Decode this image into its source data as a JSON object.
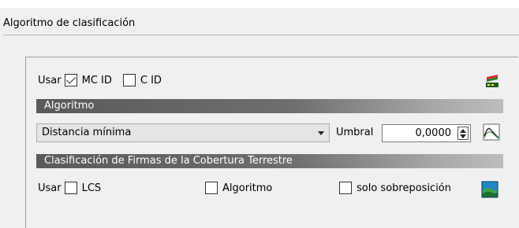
{
  "section_title": "Algoritmo de clasificación",
  "top_row": {
    "use_label": "Usar",
    "mc_id_label": "MC ID",
    "mc_id_checked": true,
    "c_id_label": "C ID",
    "c_id_checked": false,
    "icon": "signature-tool-icon"
  },
  "algorithm_bar": "Algoritmo",
  "algorithm_select": {
    "value": "Distancia mínima",
    "icon": "chevron-down-icon"
  },
  "threshold": {
    "label": "Umbral",
    "value": "0,0000",
    "icon": "spectral-plot-icon"
  },
  "lcs_bar": "Clasificación de Firmas de la Cobertura Terrestre",
  "bottom_row": {
    "use_label": "Usar",
    "lcs_label": "LCS",
    "algorithm_label": "Algoritmo",
    "overlap_label": "solo sobreposición",
    "icon": "land-cover-icon"
  }
}
